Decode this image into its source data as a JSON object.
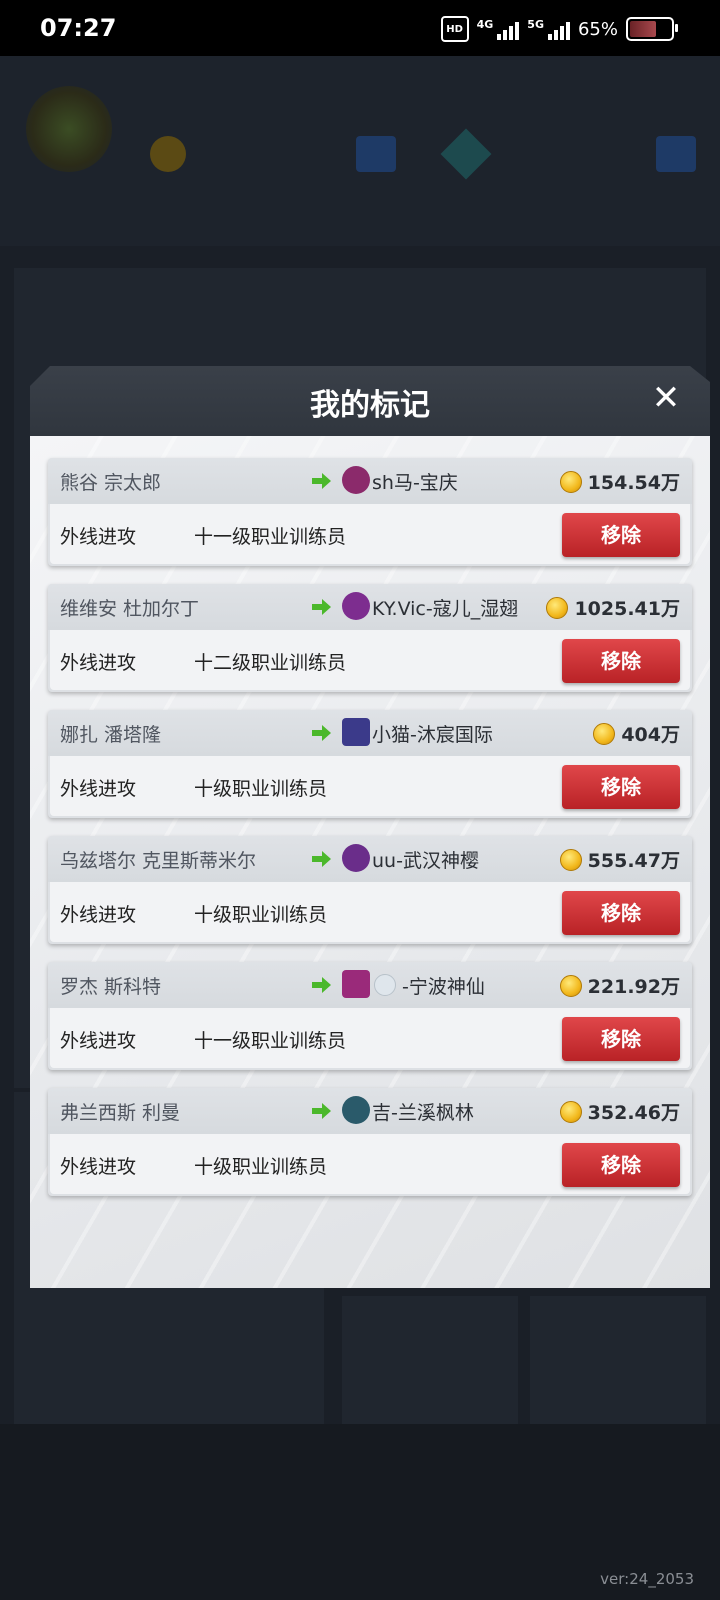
{
  "status_bar": {
    "time": "07:27",
    "hd": "HD",
    "net1": "4G",
    "net2": "5G",
    "battery": "65%"
  },
  "modal": {
    "title": "我的标记",
    "items": [
      {
        "player": "熊谷 宗太郎",
        "team": "sh马-宝庆",
        "team_color": "#8b2a6b",
        "price": "154.54万",
        "position": "外线进攻",
        "trainer": "十一级职业训练员",
        "remove_label": "移除"
      },
      {
        "player": "维维安 杜加尔丁",
        "team": "KY.Vic-寇儿_湿翅",
        "team_color": "#7d2d8f",
        "price": "1025.41万",
        "position": "外线进攻",
        "trainer": "十二级职业训练员",
        "remove_label": "移除"
      },
      {
        "player": "娜扎 潘塔隆",
        "team": "小猫-沐宸国际",
        "team_color": "#3b3a8a",
        "price": "404万",
        "position": "外线进攻",
        "trainer": "十级职业训练员",
        "remove_label": "移除"
      },
      {
        "player": "乌兹塔尔 克里斯蒂米尔",
        "team": "uu-武汉神樱",
        "team_color": "#6a2d8a",
        "price": "555.47万",
        "position": "外线进攻",
        "trainer": "十级职业训练员",
        "remove_label": "移除"
      },
      {
        "player": "罗杰 斯科特",
        "team": "-宁波神仙",
        "team_color": "#9a2a7a",
        "price": "221.92万",
        "position": "外线进攻",
        "trainer": "十一级职业训练员",
        "remove_label": "移除"
      },
      {
        "player": "弗兰西斯 利曼",
        "team": "吉-兰溪枫林",
        "team_color": "#2a5a6a",
        "price": "352.46万",
        "position": "外线进攻",
        "trainer": "十级职业训练员",
        "remove_label": "移除"
      }
    ]
  },
  "footer": {
    "version": "ver:24_2053"
  },
  "colors": {
    "remove_button": "#c8282c",
    "arrow": "#4bb82b",
    "coin": "#f2b81c"
  }
}
